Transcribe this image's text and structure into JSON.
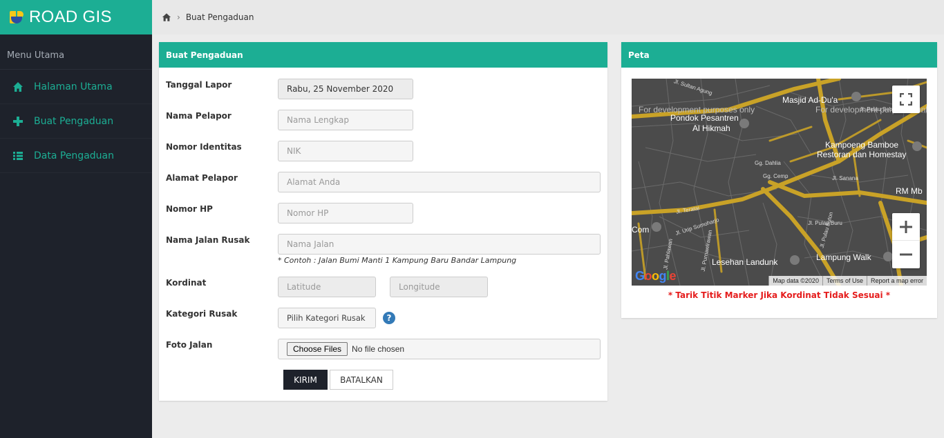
{
  "app": {
    "title": "ROAD GIS"
  },
  "sidebar": {
    "header": "Menu Utama",
    "items": [
      {
        "label": "Halaman Utama",
        "icon": "home-icon"
      },
      {
        "label": "Buat Pengaduan",
        "icon": "plus-icon"
      },
      {
        "label": "Data Pengaduan",
        "icon": "list-icon"
      }
    ]
  },
  "breadcrumb": {
    "current": "Buat Pengaduan"
  },
  "form": {
    "title": "Buat Pengaduan",
    "fields": {
      "tanggal": {
        "label": "Tanggal Lapor",
        "value": "Rabu, 25 November 2020"
      },
      "nama": {
        "label": "Nama Pelapor",
        "placeholder": "Nama Lengkap"
      },
      "nik": {
        "label": "Nomor Identitas",
        "placeholder": "NIK"
      },
      "alamat": {
        "label": "Alamat Pelapor",
        "placeholder": "Alamat Anda"
      },
      "hp": {
        "label": "Nomor HP",
        "placeholder": "Nomor HP"
      },
      "jalan": {
        "label": "Nama Jalan Rusak",
        "placeholder": "Nama Jalan",
        "hint": "* Contoh : Jalan Bumi Manti 1 Kampung Baru Bandar Lampung"
      },
      "kordinat": {
        "label": "Kordinat",
        "lat_placeholder": "Latitude",
        "lng_placeholder": "Longitude"
      },
      "kategori": {
        "label": "Kategori Rusak",
        "value": "Pilih Kategori Rusak",
        "help": "?"
      },
      "foto": {
        "label": "Foto Jalan",
        "button": "Choose Files",
        "status": "No file chosen"
      }
    },
    "submit": "KIRIM",
    "cancel": "BATALKAN"
  },
  "map_panel": {
    "title": "Peta",
    "watermark_1": "For development purposes only",
    "watermark_2": "For development purposes only",
    "places": {
      "masjid": "Masjid Ad-Du'a",
      "pondok_1": "Pondok Pesantren",
      "pondok_2": "Al Hikmah",
      "kampoeng_1": "Kampoeng Bamboe",
      "kampoeng_2": "Restoran dan Homestay",
      "rm": "RM Mb",
      "com": "Com",
      "lesehan": "Lesehan Landunk",
      "lampung_walk": "Lampung Walk"
    },
    "streets": {
      "s1": "Jl. Sultan Agung",
      "s2": "Gg. Dahlia",
      "s3": "Gg. Cemp",
      "s4": "Jl. Teratai",
      "s5": "Jl. Urip Sumoharjo",
      "s6": "Jl. Pulau Buru",
      "s7": "Jl. Pulau Sebesi",
      "s8": "Jl. Sanana",
      "s9": "Jl. Pahlawan",
      "s10": "Jl. Pulau Buton",
      "s11": "Jl. Purnawirawan"
    },
    "google": "Google",
    "footer": {
      "data": "Map data ©2020",
      "terms": "Terms of Use",
      "report": "Report a map error"
    },
    "note": "* Tarik Titik Marker Jika Kordinat Tidak Sesuai *"
  },
  "colors": {
    "accent": "#1cae94",
    "sidebar_bg": "#1e222b",
    "note": "#e51c1c",
    "road": "#c9a227"
  }
}
